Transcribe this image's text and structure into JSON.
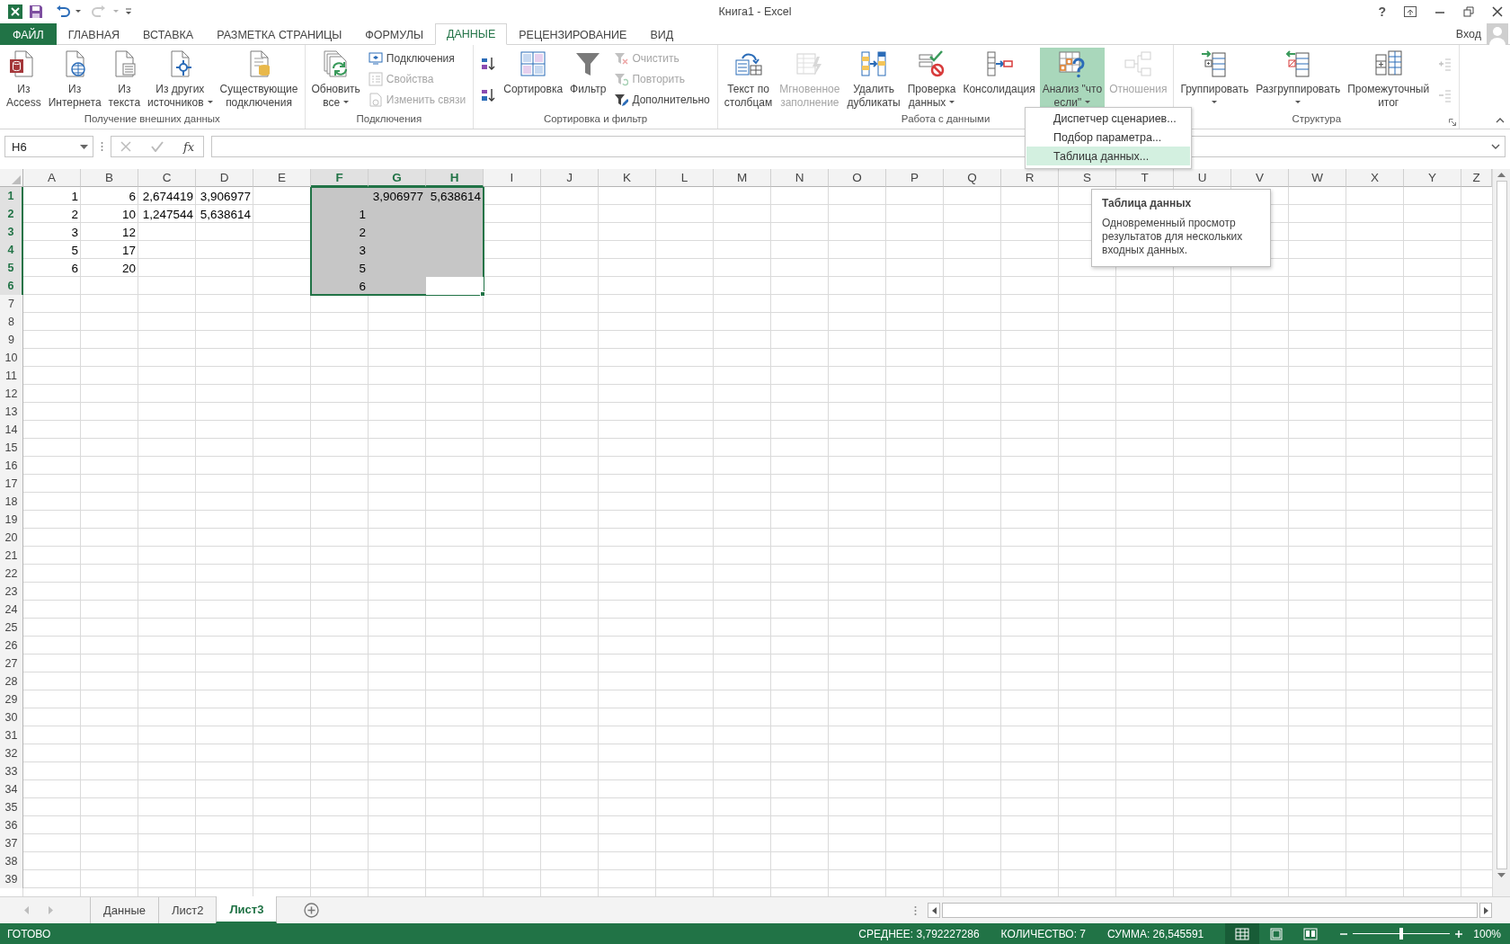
{
  "window": {
    "title": "Книга1 - Excel",
    "help": "?"
  },
  "tabs": [
    {
      "label": "ФАЙЛ",
      "kind": "file",
      "selected": false
    },
    {
      "label": "ГЛАВНАЯ",
      "kind": "tab",
      "selected": false
    },
    {
      "label": "ВСТАВКА",
      "kind": "tab",
      "selected": false
    },
    {
      "label": "РАЗМЕТКА СТРАНИЦЫ",
      "kind": "tab",
      "selected": false
    },
    {
      "label": "ФОРМУЛЫ",
      "kind": "tab",
      "selected": false
    },
    {
      "label": "ДАННЫЕ",
      "kind": "tab",
      "selected": true
    },
    {
      "label": "РЕЦЕНЗИРОВАНИЕ",
      "kind": "tab",
      "selected": false
    },
    {
      "label": "ВИД",
      "kind": "tab",
      "selected": false
    }
  ],
  "account": {
    "label": "Вход"
  },
  "ribbon": {
    "groups": [
      {
        "label": "Получение внешних данных",
        "launcher": false,
        "items": [
          {
            "kind": "large",
            "label": "Из\nAccess",
            "disabled": false,
            "dropdown": false,
            "pressed": false
          },
          {
            "kind": "large",
            "label": "Из\nИнтернета",
            "disabled": false,
            "dropdown": false,
            "pressed": false
          },
          {
            "kind": "large",
            "label": "Из\nтекста",
            "disabled": false,
            "dropdown": false,
            "pressed": false
          },
          {
            "kind": "large",
            "label": "Из других\nисточников",
            "disabled": false,
            "dropdown": true,
            "pressed": false
          },
          {
            "kind": "large",
            "label": "Существующие\nподключения",
            "disabled": false,
            "dropdown": false,
            "pressed": false
          }
        ]
      },
      {
        "label": "Подключения",
        "launcher": false,
        "items": [
          {
            "kind": "large",
            "label": "Обновить\nвсе",
            "disabled": false,
            "dropdown": true,
            "pressed": false
          },
          {
            "kind": "stack",
            "items": [
              {
                "label": "Подключения",
                "disabled": false
              },
              {
                "label": "Свойства",
                "disabled": true
              },
              {
                "label": "Изменить связи",
                "disabled": true
              }
            ]
          }
        ]
      },
      {
        "label": "Сортировка и фильтр",
        "launcher": false,
        "items": [
          {
            "kind": "stack",
            "items": [
              {
                "disabled": false
              },
              {
                "disabled": false
              }
            ]
          },
          {
            "kind": "large",
            "label": "Сортировка",
            "disabled": false,
            "dropdown": false,
            "pressed": false
          },
          {
            "kind": "large",
            "label": "Фильтр",
            "disabled": false,
            "dropdown": false,
            "pressed": false
          },
          {
            "kind": "stack",
            "items": [
              {
                "label": "Очистить",
                "disabled": true
              },
              {
                "label": "Повторить",
                "disabled": true
              },
              {
                "label": "Дополнительно",
                "disabled": false
              }
            ]
          }
        ]
      },
      {
        "label": "Работа с данными",
        "launcher": false,
        "items": [
          {
            "kind": "large",
            "label": "Текст по\nстолбцам",
            "disabled": false,
            "dropdown": false,
            "pressed": false
          },
          {
            "kind": "large",
            "label": "Мгновенное\nзаполнение",
            "disabled": true,
            "dropdown": false,
            "pressed": false
          },
          {
            "kind": "large",
            "label": "Удалить\nдубликаты",
            "disabled": false,
            "dropdown": false,
            "pressed": false
          },
          {
            "kind": "large",
            "label": "Проверка\nданных",
            "disabled": false,
            "dropdown": true,
            "pressed": false
          },
          {
            "kind": "large",
            "label": "Консолидация",
            "disabled": false,
            "dropdown": false,
            "pressed": false
          },
          {
            "kind": "large",
            "label": "Анализ \"что\nесли\"",
            "disabled": false,
            "dropdown": true,
            "pressed": true
          },
          {
            "kind": "large",
            "label": "Отношения",
            "disabled": true,
            "dropdown": false,
            "pressed": false
          }
        ]
      },
      {
        "label": "Структура",
        "launcher": true,
        "items": [
          {
            "kind": "large",
            "label": "Группировать",
            "disabled": false,
            "dropdown": true,
            "pressed": false
          },
          {
            "kind": "large",
            "label": "Разгруппировать",
            "disabled": false,
            "dropdown": true,
            "pressed": false
          },
          {
            "kind": "large",
            "label": "Промежуточный\nитог",
            "disabled": false,
            "dropdown": false,
            "pressed": false
          },
          {
            "kind": "stack",
            "items": [
              {
                "disabled": true
              },
              {
                "disabled": true
              }
            ]
          }
        ]
      }
    ]
  },
  "whatif_menu": {
    "items": [
      {
        "label": "Диспетчер сценариев...",
        "selected": false
      },
      {
        "label": "Подбор параметра...",
        "selected": false
      },
      {
        "label": "Таблица данных...",
        "selected": true
      }
    ]
  },
  "tooltip": {
    "title": "Таблица данных",
    "text": "Одновременный просмотр результатов для нескольких входных данных."
  },
  "formula_bar": {
    "name_box": "H6",
    "function_label": "fx"
  },
  "sheet": {
    "columns": [
      {
        "label": "A",
        "selected": false
      },
      {
        "label": "B",
        "selected": false
      },
      {
        "label": "C",
        "selected": false
      },
      {
        "label": "D",
        "selected": false
      },
      {
        "label": "E",
        "selected": false
      },
      {
        "label": "F",
        "selected": true
      },
      {
        "label": "G",
        "selected": true
      },
      {
        "label": "H",
        "selected": true
      },
      {
        "label": "I",
        "selected": false
      },
      {
        "label": "J",
        "selected": false
      },
      {
        "label": "K",
        "selected": false
      },
      {
        "label": "L",
        "selected": false
      },
      {
        "label": "M",
        "selected": false
      },
      {
        "label": "N",
        "selected": false
      },
      {
        "label": "O",
        "selected": false
      },
      {
        "label": "P",
        "selected": false
      },
      {
        "label": "Q",
        "selected": false
      },
      {
        "label": "R",
        "selected": false
      },
      {
        "label": "S",
        "selected": false
      },
      {
        "label": "T",
        "selected": false
      },
      {
        "label": "U",
        "selected": false
      },
      {
        "label": "V",
        "selected": false
      },
      {
        "label": "W",
        "selected": false
      },
      {
        "label": "X",
        "selected": false
      },
      {
        "label": "Y",
        "selected": false
      },
      {
        "label": "Z",
        "selected": false
      }
    ],
    "rows": [
      {
        "label": "1",
        "selected": true,
        "cells": [
          "1",
          "6",
          "2,674419",
          "3,906977",
          null,
          null,
          "3,906977",
          "5,638614"
        ]
      },
      {
        "label": "2",
        "selected": true,
        "cells": [
          "2",
          "10",
          "1,247544",
          "5,638614",
          null,
          "1"
        ]
      },
      {
        "label": "3",
        "selected": true,
        "cells": [
          "3",
          "12",
          null,
          null,
          null,
          "2"
        ]
      },
      {
        "label": "4",
        "selected": true,
        "cells": [
          "5",
          "17",
          null,
          null,
          null,
          "3"
        ]
      },
      {
        "label": "5",
        "selected": true,
        "cells": [
          "6",
          "20",
          null,
          null,
          null,
          "5"
        ]
      },
      {
        "label": "6",
        "selected": true,
        "cells": [
          null,
          null,
          null,
          null,
          null,
          "6",
          null,
          {
            "active": true
          }
        ]
      },
      {
        "label": "7",
        "selected": false
      },
      {
        "label": "8",
        "selected": false
      },
      {
        "label": "9",
        "selected": false
      },
      {
        "label": "10",
        "selected": false
      },
      {
        "label": "11",
        "selected": false
      },
      {
        "label": "12",
        "selected": false
      },
      {
        "label": "13",
        "selected": false
      },
      {
        "label": "14",
        "selected": false
      },
      {
        "label": "15",
        "selected": false
      },
      {
        "label": "16",
        "selected": false
      },
      {
        "label": "17",
        "selected": false
      },
      {
        "label": "18",
        "selected": false
      },
      {
        "label": "19",
        "selected": false
      },
      {
        "label": "20",
        "selected": false
      },
      {
        "label": "21",
        "selected": false
      },
      {
        "label": "22",
        "selected": false
      },
      {
        "label": "23",
        "selected": false
      },
      {
        "label": "24",
        "selected": false
      },
      {
        "label": "25",
        "selected": false
      },
      {
        "label": "26",
        "selected": false
      },
      {
        "label": "27",
        "selected": false
      },
      {
        "label": "28",
        "selected": false
      },
      {
        "label": "29",
        "selected": false
      },
      {
        "label": "30",
        "selected": false
      },
      {
        "label": "31",
        "selected": false
      },
      {
        "label": "32",
        "selected": false
      },
      {
        "label": "33",
        "selected": false
      },
      {
        "label": "34",
        "selected": false
      },
      {
        "label": "35",
        "selected": false
      },
      {
        "label": "36",
        "selected": false
      },
      {
        "label": "37",
        "selected": false
      },
      {
        "label": "38",
        "selected": false
      },
      {
        "label": "39",
        "selected": false
      }
    ]
  },
  "sheet_tabs": [
    {
      "label": "Данные",
      "selected": false
    },
    {
      "label": "Лист2",
      "selected": false
    },
    {
      "label": "Лист3",
      "selected": true
    }
  ],
  "status_bar": {
    "mode": "ГОТОВО",
    "average": "СРЕДНЕЕ: 3,792227286",
    "count": "КОЛИЧЕСТВО: 7",
    "sum": "СУММА: 26,545591",
    "views": [
      {
        "kind": "normal",
        "selected": true
      },
      {
        "kind": "page_layout",
        "selected": false
      },
      {
        "kind": "page_break",
        "selected": false
      }
    ],
    "zoom": {
      "level": 0.5,
      "reading": "100%"
    }
  }
}
